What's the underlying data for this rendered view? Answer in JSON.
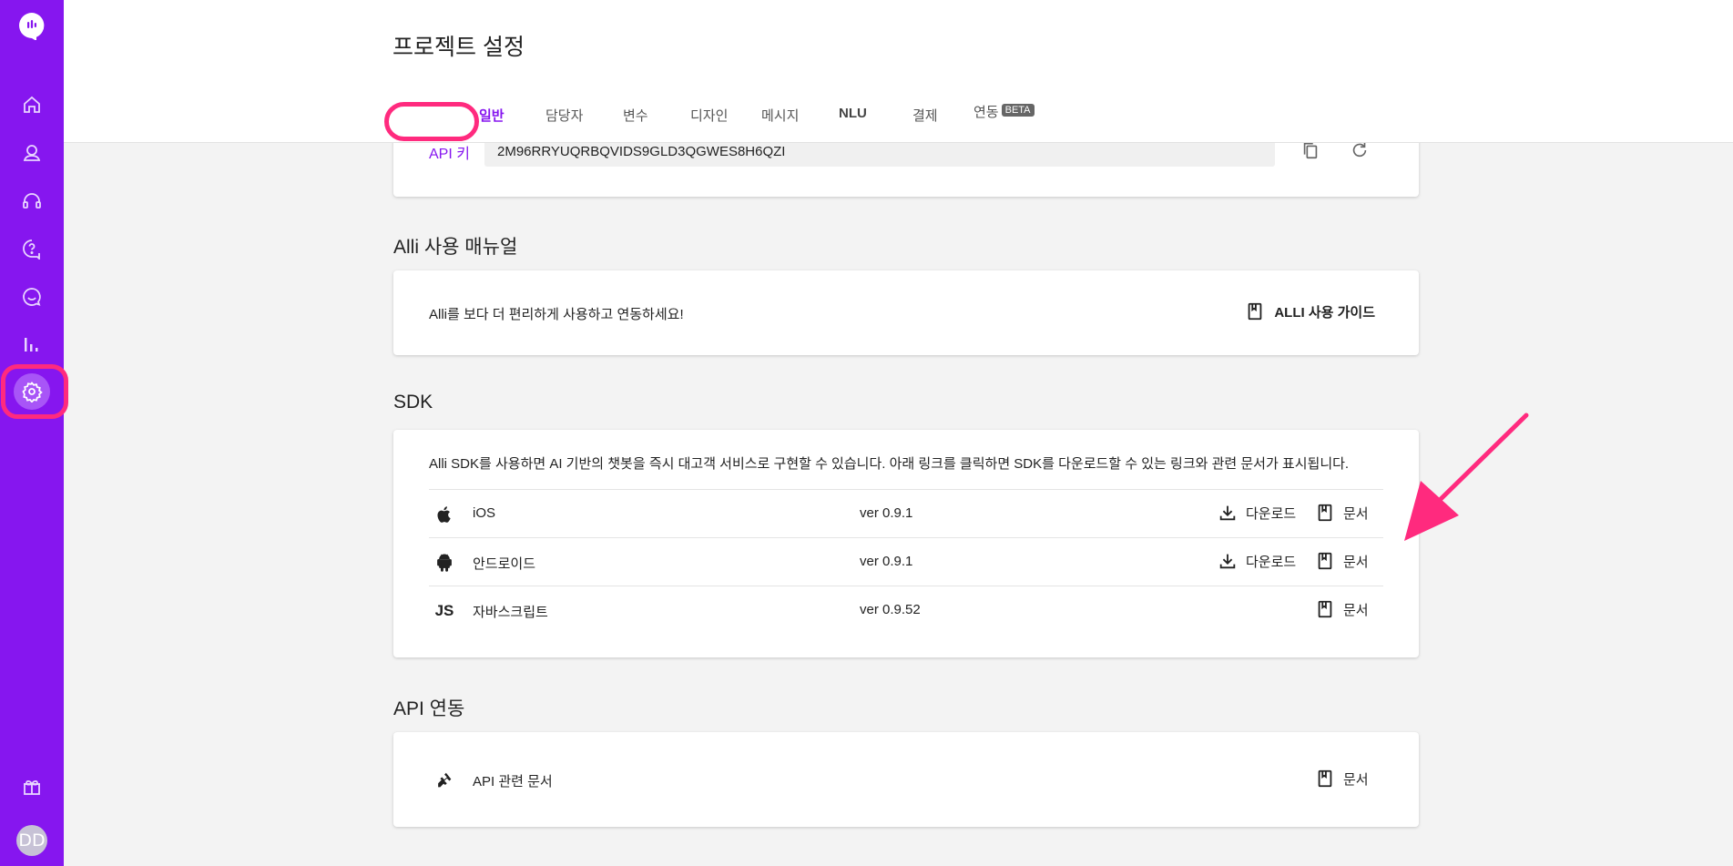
{
  "sidebar": {
    "logo": "alli-logo-icon",
    "items": [
      {
        "icon": "home-icon"
      },
      {
        "icon": "user-icon"
      },
      {
        "icon": "headset-icon"
      },
      {
        "icon": "help-icon"
      },
      {
        "icon": "chat-icon"
      },
      {
        "icon": "bar-chart-icon"
      },
      {
        "icon": "gear-icon"
      }
    ],
    "gift_icon": "gift-icon",
    "avatar": "DD"
  },
  "header": {
    "title": "프로젝트 설정",
    "tabs": [
      {
        "label": "일반",
        "active": true
      },
      {
        "label": "담당자"
      },
      {
        "label": "변수"
      },
      {
        "label": "디자인"
      },
      {
        "label": "메시지"
      },
      {
        "label": "NLU"
      },
      {
        "label": "결제"
      },
      {
        "label": "연동",
        "badge": "BETA"
      }
    ]
  },
  "api_key": {
    "label": "API 키",
    "value": "2M96RRYUQRBQVIDS9GLD3QGWES8H6QZI"
  },
  "manual": {
    "title": "Alli 사용 매뉴얼",
    "text": "Alli를 보다 더 편리하게 사용하고 연동하세요!",
    "button": "ALLI 사용 가이드"
  },
  "sdk": {
    "title": "SDK",
    "description": "Alli SDK를 사용하면 AI 기반의 챗봇을 즉시 대고객 서비스로 구현할 수 있습니다. 아래 링크를 클릭하면 SDK를 다운로드할 수 있는 링크와 관련 문서가 표시됩니다.",
    "rows": [
      {
        "icon": "apple-icon",
        "name": "iOS",
        "version": "ver 0.9.1",
        "download": "다운로드",
        "docs": "문서"
      },
      {
        "icon": "android-icon",
        "name": "안드로이드",
        "version": "ver 0.9.1",
        "download": "다운로드",
        "docs": "문서"
      },
      {
        "icon": "js-icon",
        "icon_text": "JS",
        "name": "자바스크립트",
        "version": "ver 0.9.52",
        "docs": "문서"
      }
    ]
  },
  "api": {
    "title": "API 연동",
    "row": {
      "icon": "plug-icon",
      "name": "API 관련 문서",
      "docs": "문서"
    }
  },
  "colors": {
    "sidebar": "#8616ef",
    "accent": "#8616ef",
    "highlight": "#ff2a7e"
  }
}
